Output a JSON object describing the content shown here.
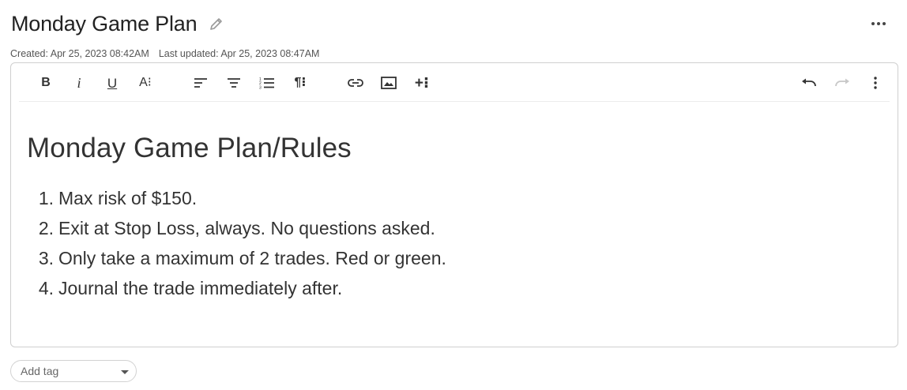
{
  "header": {
    "title": "Monday Game Plan",
    "created": "Created: Apr 25, 2023 08:42AM",
    "updated": "Last updated: Apr 25, 2023 08:47AM"
  },
  "toolbar": {
    "bold": "B",
    "italic": "i",
    "underline": "U",
    "text_style": "A⁝",
    "paragraph": "¶⁝",
    "insert": "+⁝"
  },
  "content": {
    "heading": "Monday Game Plan/Rules",
    "rules": [
      {
        "num": "1.",
        "text": "Max risk of $150."
      },
      {
        "num": "2.",
        "text": "Exit at Stop Loss, always. No questions asked."
      },
      {
        "num": "3.",
        "text": "Only take a maximum of 2 trades. Red or green."
      },
      {
        "num": "4.",
        "text": "Journal the trade immediately after."
      }
    ]
  },
  "tag": {
    "placeholder": "Add tag"
  },
  "colors": {
    "text": "#333333",
    "border": "#cfcfcf",
    "icon_disabled": "#c8c8c8"
  }
}
